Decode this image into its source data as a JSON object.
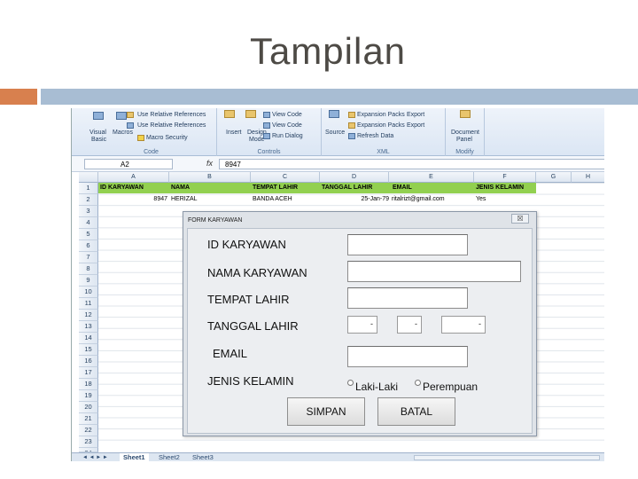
{
  "slide": {
    "title": "Tampilan"
  },
  "ribbon": {
    "code": {
      "items": [
        "Visual Basic",
        "Macros",
        "Use Relative References",
        "Macro Security"
      ],
      "visual": "Visual",
      "basic": "Basic",
      "macros": "Macros",
      "record1": "Use Relative References",
      "record2": "Use Relative References",
      "security": "Macro Security",
      "group": "Code"
    },
    "controls": {
      "insert": "Insert",
      "design1": "Design",
      "design2": "Mode",
      "view_code": "View Code",
      "properties": "View Code",
      "run_dialog": "Run Dialog",
      "group": "Controls"
    },
    "xml": {
      "source": "Source",
      "exp1": "Expansion Packs",
      "exp2": "Expansion Packs",
      "refresh": "Refresh Data",
      "export1": "Export",
      "export2": "Export",
      "group": "XML"
    },
    "modify": {
      "doc1": "Document",
      "doc2": "Panel",
      "group": "Modify"
    }
  },
  "formula_bar": {
    "cell_ref": "A2",
    "fx": "fx",
    "value": "8947"
  },
  "sheet": {
    "columns": [
      "A",
      "B",
      "C",
      "D",
      "E",
      "F",
      "G",
      "H"
    ],
    "rows": [
      "1",
      "2",
      "3",
      "4",
      "5",
      "6",
      "7",
      "8",
      "9",
      "10",
      "11",
      "12",
      "13",
      "14",
      "15",
      "16",
      "17",
      "18",
      "19",
      "20",
      "21",
      "22",
      "23",
      "24"
    ],
    "header_row": [
      "ID KARYAWAN",
      "NAMA",
      "TEMPAT LAHIR",
      "TANGGAL LAHIR",
      "EMAIL",
      "JENIS KELAMIN"
    ],
    "data_row": [
      "8947",
      "HERIZAL",
      "BANDA ACEH",
      "25-Jan-79",
      "ritalrizt@gmail.com",
      "Yes"
    ],
    "tabs": [
      "Sheet1",
      "Sheet2",
      "Sheet3"
    ],
    "tab_nav": "◄ ◄ ► ►"
  },
  "form": {
    "title": "FORM KARYAWAN",
    "close": "☒",
    "labels": {
      "id": "ID KARYAWAN",
      "nama": "NAMA KARYAWAN",
      "tempat": "TEMPAT LAHIR",
      "tanggal": "TANGGAL LAHIR",
      "email": "EMAIL",
      "jenis": "JENIS KELAMIN"
    },
    "fields": {
      "id": "",
      "nama": "",
      "tempat": "",
      "email": ""
    },
    "date_combos": [
      "",
      "",
      ""
    ],
    "combo_arrow": "-",
    "radios": [
      "Laki-Laki",
      "Perempuan"
    ],
    "buttons": {
      "save": "SIMPAN",
      "cancel": "BATAL"
    }
  }
}
